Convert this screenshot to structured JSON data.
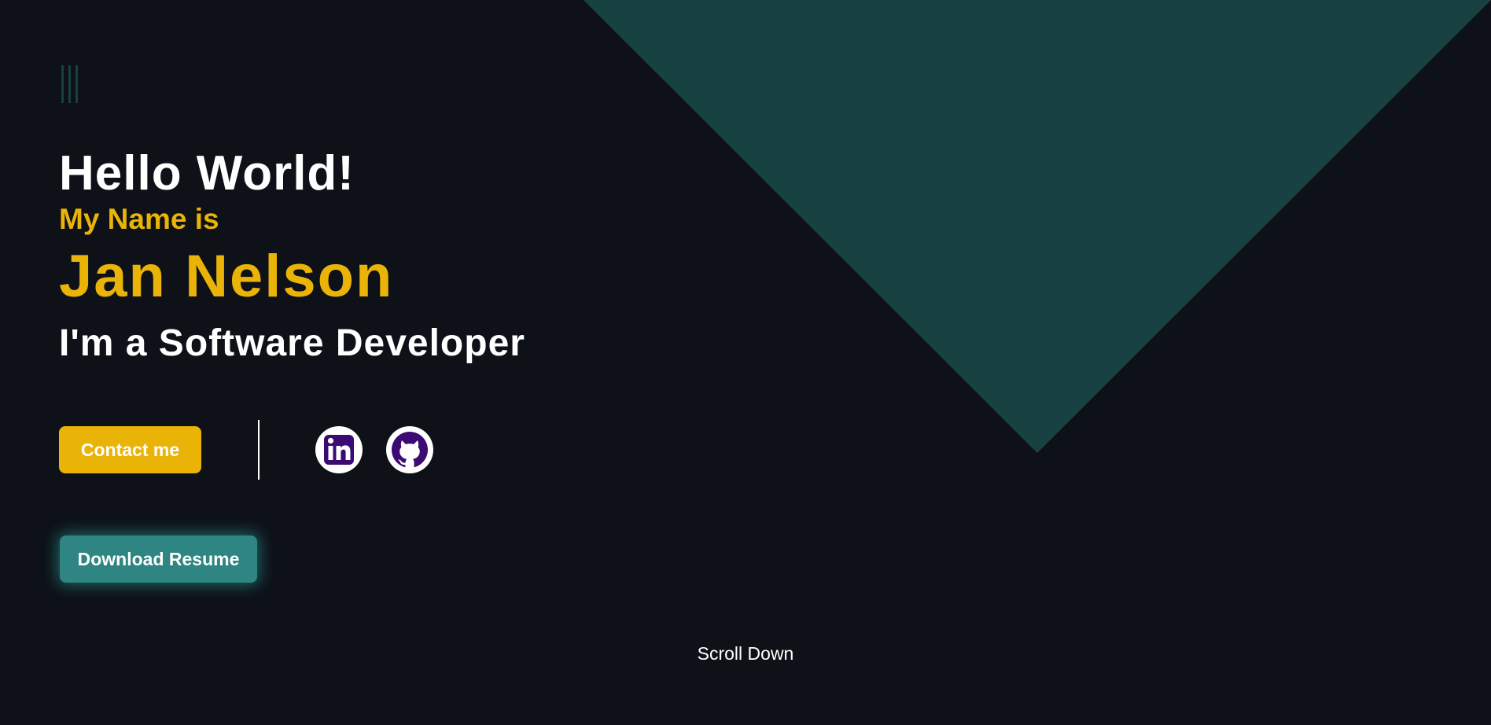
{
  "theme": {
    "background": "#0e1118",
    "triangle_color": "#184242",
    "accent_yellow": "#eab308",
    "accent_teal": "#2e8582",
    "icon_purple": "#3b0a72"
  },
  "menu": {
    "icon": "hamburger-vertical-icon"
  },
  "hero": {
    "greeting": "Hello World!",
    "intro": "My Name is",
    "name": "Jan Nelson",
    "role": "I'm a Software Developer"
  },
  "actions": {
    "contact_label": "Contact me",
    "socials": [
      {
        "icon": "linkedin-icon"
      },
      {
        "icon": "github-icon"
      }
    ],
    "resume_label": "Download Resume"
  },
  "footer": {
    "scroll_label": "Scroll Down"
  }
}
